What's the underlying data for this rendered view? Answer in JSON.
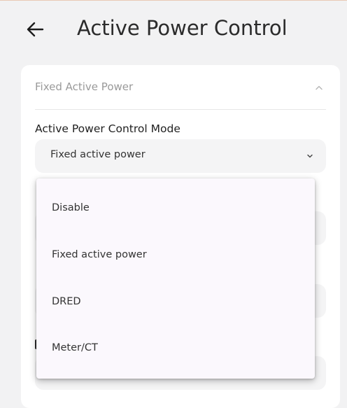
{
  "header": {
    "title": "Active Power Control",
    "back_icon": "arrow-left-icon"
  },
  "section": {
    "title": "Fixed Active Power",
    "collapse_icon": "chevron-up-icon"
  },
  "mode_field": {
    "label": "Active Power Control Mode",
    "value": "Fixed active power",
    "dropdown_icon": "chevron-down-icon"
  },
  "dropdown": {
    "options": [
      {
        "label": "Disable"
      },
      {
        "label": "Fixed active power"
      },
      {
        "label": "DRED"
      },
      {
        "label": "Meter/CT"
      }
    ]
  },
  "colors": {
    "background": "#f2f2f3",
    "card": "#ffffff",
    "menu": "#fbf8fd",
    "title_text": "#2b2b2b",
    "muted_text": "#9a9a9a"
  }
}
